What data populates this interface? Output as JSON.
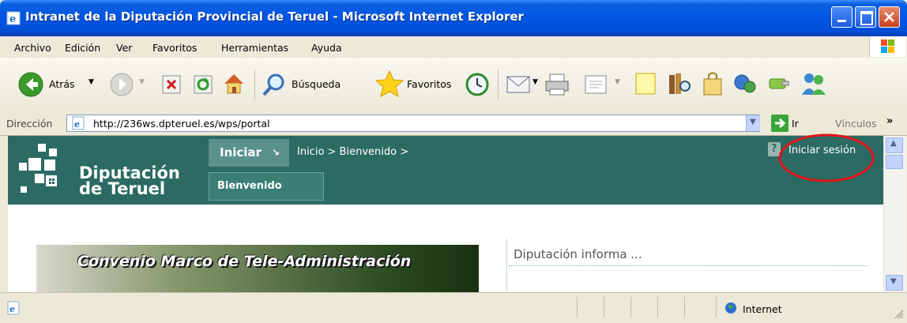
{
  "window": {
    "title": "Intranet de la Diputación Provincial de Teruel - Microsoft Internet Explorer"
  },
  "menubar": {
    "items": [
      "Archivo",
      "Edición",
      "Ver",
      "Favoritos",
      "Herramientas",
      "Ayuda"
    ]
  },
  "toolbar": {
    "back_label": "Atrás",
    "search_label": "Búsqueda",
    "favorites_label": "Favoritos"
  },
  "addressbar": {
    "label": "Dirección",
    "url": "http://236ws.dpteruel.es/wps/portal",
    "go_label": "Ir",
    "links_label": "Vínculos"
  },
  "page": {
    "logo_line1": "Diputación",
    "logo_line2": "de Teruel",
    "start_menu_label": "Iniciar",
    "breadcrumb": "Inicio > Bienvenido >",
    "login_label": "Iniciar sesión",
    "help_icon_text": "?",
    "welcome_tab": "Bienvenido",
    "promo_title": "Convenio Marco de Tele-Administración",
    "news_title": "Diputación informa ..."
  },
  "statusbar": {
    "zone": "Internet"
  },
  "colors": {
    "titlebar": "#0055e5",
    "portal_banner": "#2b6b63",
    "annotation_circle": "#e0141a"
  }
}
